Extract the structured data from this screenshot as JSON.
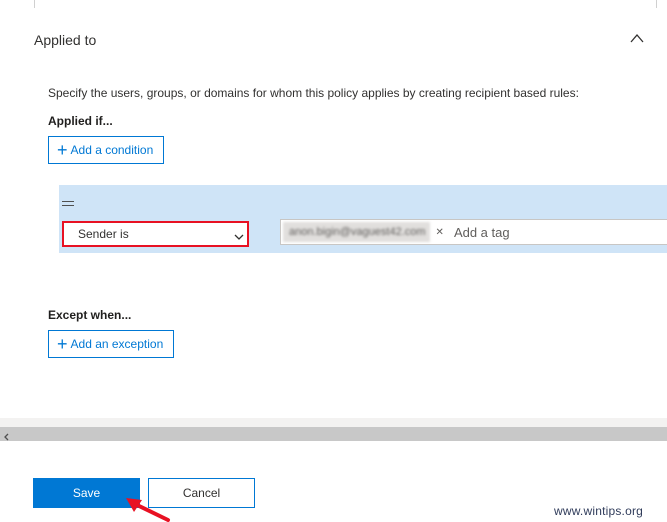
{
  "section": {
    "title": "Applied to",
    "description": "Specify the users, groups, or domains for whom this policy applies by creating recipient based rules:"
  },
  "applied_if": {
    "heading": "Applied if...",
    "add_condition_label": "Add a condition"
  },
  "condition": {
    "selected_option": "Sender is",
    "tag_value": "anon.bigin@vaguest42.com",
    "tag_placeholder": "Add a tag"
  },
  "except_when": {
    "heading": "Except when...",
    "add_exception_label": "Add an exception"
  },
  "footer": {
    "save_label": "Save",
    "cancel_label": "Cancel"
  },
  "watermark": "www.wintips.org",
  "colors": {
    "primary": "#0078d4",
    "highlight_border": "#e81123",
    "condition_band": "#cfe4f7",
    "arrow": "#e81123"
  }
}
